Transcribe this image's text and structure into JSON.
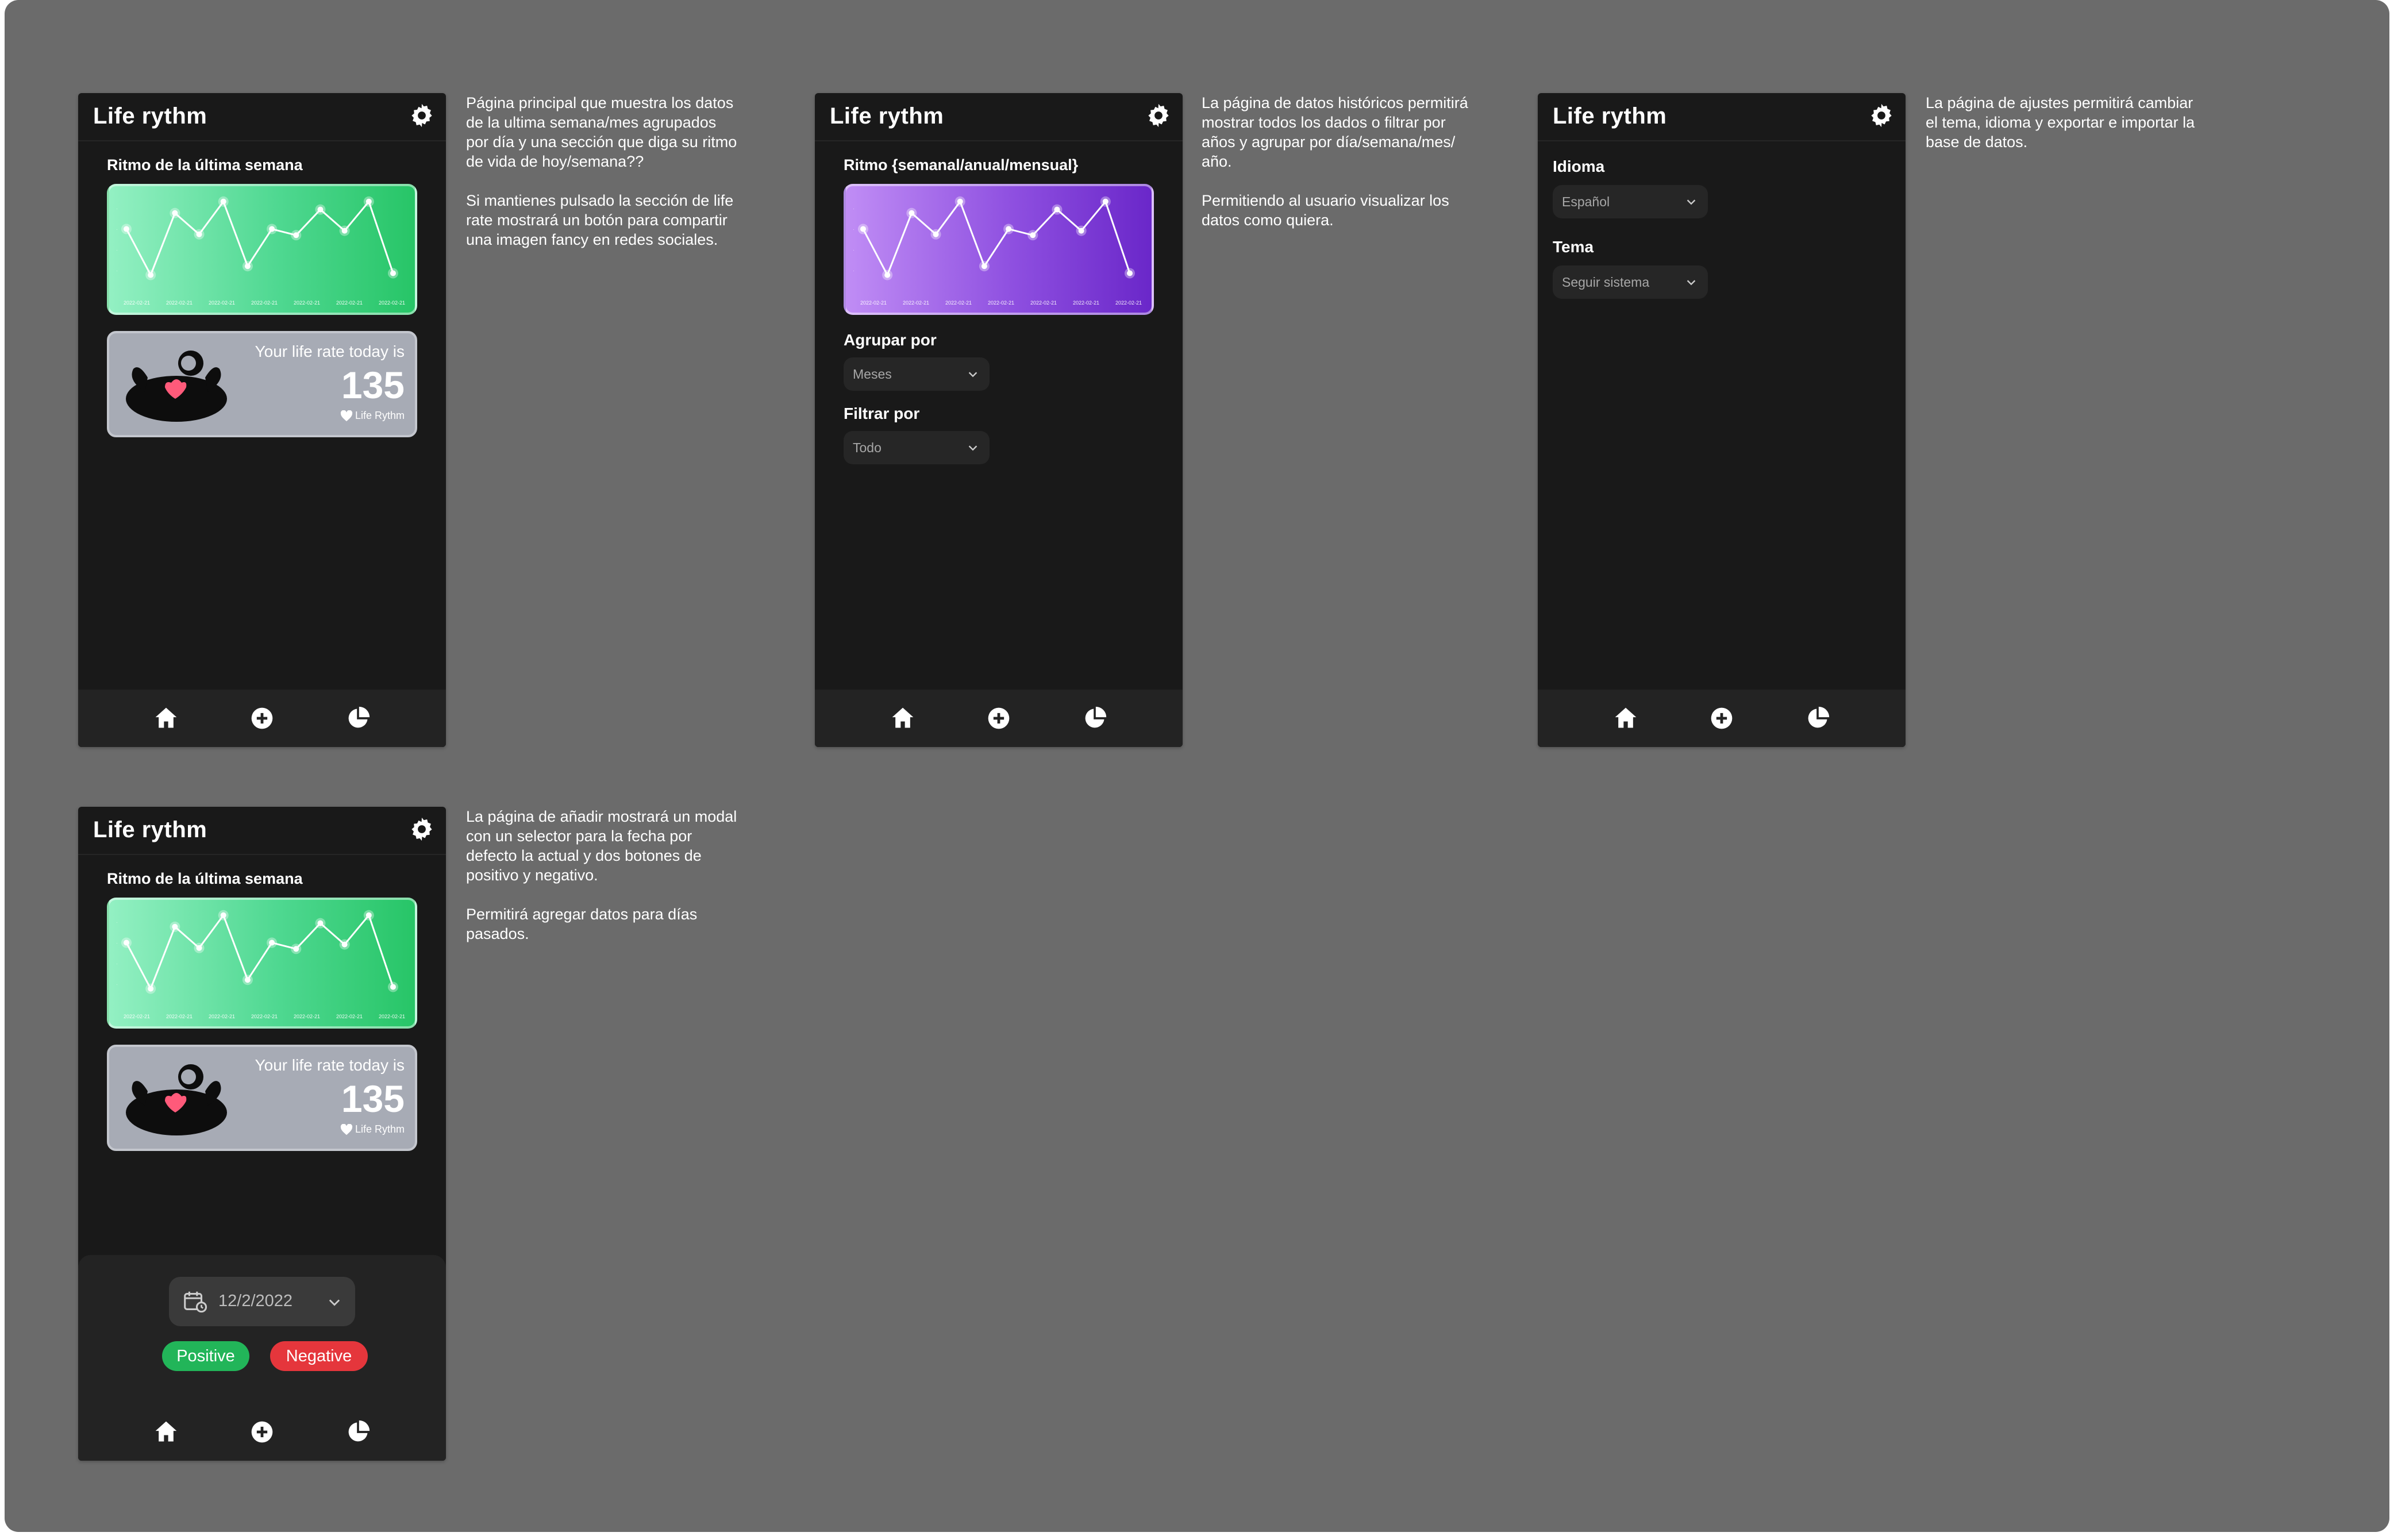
{
  "app": {
    "title": "Life rythm",
    "accent_green": "#27c567",
    "accent_purple": "#7a34d6",
    "positive_color": "#22b559",
    "negative_color": "#e5363c"
  },
  "home_screen": {
    "section_title": "Ritmo de la última semana",
    "chart_x_labels": [
      "2022-02-21",
      "2022-02-21",
      "2022-02-21",
      "2022-02-21",
      "2022-02-21",
      "2022-02-21",
      "2022-02-21"
    ],
    "rate_text": "Your life rate today is",
    "rate_value": "135",
    "brand": "Life Rythm"
  },
  "history_screen": {
    "section_title": "Ritmo {semanal/anual/mensual}",
    "chart_x_labels": [
      "2022-02-21",
      "2022-02-21",
      "2022-02-21",
      "2022-02-21",
      "2022-02-21",
      "2022-02-21",
      "2022-02-21"
    ],
    "group_label": "Agrupar por",
    "group_value": "Meses",
    "filter_label": "Filtrar por",
    "filter_value": "Todo"
  },
  "settings_screen": {
    "language_label": "Idioma",
    "language_value": "Español",
    "theme_label": "Tema",
    "theme_value": "Seguir sistema"
  },
  "add_screen": {
    "date_value": "12/2/2022",
    "positive_label": "Positive",
    "negative_label": "Negative"
  },
  "notes": {
    "home": "Página principal que muestra los datos\nde la ultima semana/mes agrupados\npor día y una sección que diga su ritmo\nde vida de hoy/semana??\n\nSi mantienes pulsado la sección de life\nrate mostrará un botón para compartir\nuna imagen fancy en redes sociales.",
    "history": "La página de datos históricos permitirá\nmostrar todos los dados o filtrar por\naños y agrupar por día/semana/mes/\naño.\n\nPermitiendo al usuario visualizar los\ndatos como quiera.",
    "settings": "La página de ajustes permitirá cambiar\nel tema, idioma y exportar e importar la\nbase  de datos.",
    "add": "La página de añadir mostrará un modal\ncon un selector para la fecha por\ndefecto la actual y dos botones de\npositivo y negativo.\n\nPermitirá agregar datos para días\npasados."
  },
  "chart_data": [
    {
      "type": "line",
      "x": [
        "2022-02-21",
        "2022-02-21",
        "2022-02-21",
        "2022-02-21",
        "2022-02-21",
        "2022-02-21",
        "2022-02-21"
      ],
      "values": [
        0.62,
        0.1,
        0.8,
        0.56,
        0.93,
        0.2,
        0.62,
        0.55,
        0.84,
        0.6,
        0.93,
        0.12
      ]
    },
    {
      "type": "line",
      "x": [
        "2022-02-21",
        "2022-02-21",
        "2022-02-21",
        "2022-02-21",
        "2022-02-21",
        "2022-02-21",
        "2022-02-21"
      ],
      "values": [
        0.62,
        0.1,
        0.8,
        0.56,
        0.93,
        0.2,
        0.62,
        0.55,
        0.84,
        0.6,
        0.93,
        0.12
      ]
    },
    {
      "type": "line",
      "x": [
        "2022-02-21",
        "2022-02-21",
        "2022-02-21",
        "2022-02-21",
        "2022-02-21",
        "2022-02-21",
        "2022-02-21"
      ],
      "values": [
        0.62,
        0.1,
        0.8,
        0.56,
        0.93,
        0.2,
        0.62,
        0.55,
        0.84,
        0.6,
        0.93,
        0.12
      ]
    }
  ]
}
